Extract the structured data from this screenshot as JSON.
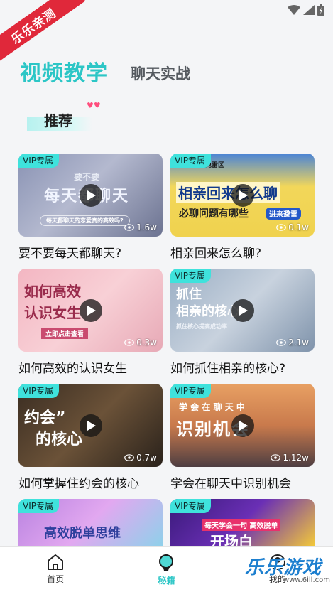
{
  "ribbon": {
    "text": "乐乐亲测"
  },
  "tabs": {
    "active": "视频教学",
    "inactive": "聊天实战"
  },
  "section": {
    "title": "推荐"
  },
  "cards": [
    {
      "title": "要不要每天都聊天?",
      "badge": "VIP专属",
      "views": "1.6w",
      "overlay1": "要不要",
      "overlay2": "每天都聊天",
      "overlay3": "每天都聊天的恋爱真的高效吗?"
    },
    {
      "title": "相亲回来怎么聊?",
      "badge": "VIP专属",
      "views": "0.1w",
      "overlay1": "避免雷区",
      "overlay2": "相亲回来怎么聊",
      "overlay3": "必聊问题有哪些",
      "overlay4": "进来避雷"
    },
    {
      "title": "如何高效的认识女生",
      "badge": "",
      "views": "0.3w",
      "overlay1": "如何高效",
      "overlay2": "认识女生",
      "overlay3": "立即点击查看"
    },
    {
      "title": "如何抓住相亲的核心?",
      "badge": "VIP专属",
      "views": "2.1w",
      "overlay1": "抓住",
      "overlay2": "相亲的核心",
      "overlay3": "抓住核心提高成功率"
    },
    {
      "title": "如何掌握住约会的核心",
      "badge": "VIP专属",
      "views": "0.7w",
      "overlay1": "约会”",
      "overlay2": "的核心"
    },
    {
      "title": "学会在聊天中识别机会",
      "badge": "VIP专属",
      "views": "1.12w",
      "overlay1": "学 会 在 聊 天 中",
      "overlay2": "识别机会"
    },
    {
      "title": "",
      "badge": "VIP专属",
      "views": "",
      "overlay1": "高效脱单思维"
    },
    {
      "title": "",
      "badge": "VIP专属",
      "views": "",
      "overlay1": "每天学会一句 高效脱单",
      "overlay2": "开场白"
    }
  ],
  "nav": [
    {
      "label": "首页",
      "icon": "home-icon"
    },
    {
      "label": "秘籍",
      "icon": "bulb-icon"
    },
    {
      "label": "我的",
      "icon": "profile-icon"
    }
  ],
  "watermark": {
    "main": "乐乐游戏",
    "sub": "www.6ill.com"
  },
  "colors": {
    "accent": "#2cc6c6",
    "vip": "#3fe2dc"
  }
}
